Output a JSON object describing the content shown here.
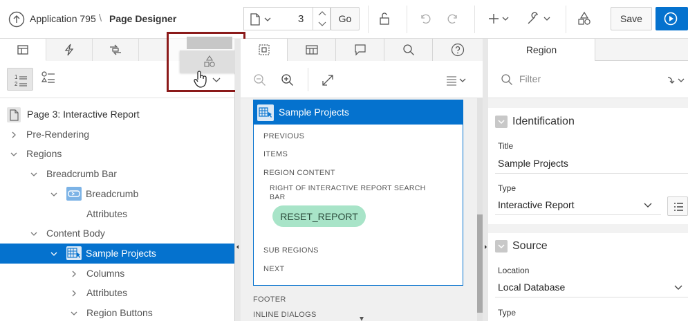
{
  "toolbar": {
    "app_label": "Application 795",
    "separator": "\\",
    "page_designer_label": "Page Designer",
    "page_number": "3",
    "go_label": "Go",
    "save_label": "Save"
  },
  "left_pane": {
    "tabs": [
      "rendering-tab",
      "dynamic-actions-tab",
      "processing-tab",
      "shared-components-tab"
    ],
    "tree": [
      {
        "label": "Page 3: Interactive Report",
        "level": 0,
        "icon": "page-icon"
      },
      {
        "label": "Pre-Rendering",
        "level": 0,
        "chevron": "right"
      },
      {
        "label": "Regions",
        "level": 0,
        "chevron": "down"
      },
      {
        "label": "Breadcrumb Bar",
        "level": 1,
        "chevron": "down"
      },
      {
        "label": "Breadcrumb",
        "level": 2,
        "chevron": "down",
        "icon": "breadcrumb-icon"
      },
      {
        "label": "Attributes",
        "level": 3
      },
      {
        "label": "Content Body",
        "level": 1,
        "chevron": "down"
      },
      {
        "label": "Sample Projects",
        "level": 2,
        "chevron": "down",
        "icon": "report-icon",
        "selected": true
      },
      {
        "label": "Columns",
        "level": 3,
        "chevron": "right"
      },
      {
        "label": "Attributes",
        "level": 3,
        "chevron": "right"
      },
      {
        "label": "Region Buttons",
        "level": 3,
        "chevron": "down"
      }
    ]
  },
  "middle_pane": {
    "region_title": "Sample Projects",
    "slots": {
      "previous": "PREVIOUS",
      "items": "ITEMS",
      "region_content": "REGION CONTENT",
      "right_of_search_line1": "RIGHT OF INTERACTIVE REPORT SEARCH",
      "right_of_search_line2": "BAR",
      "sub_regions": "SUB REGIONS",
      "next": "NEXT"
    },
    "reset_button": "RESET_REPORT",
    "footer": "FOOTER",
    "inline_dialogs": "INLINE DIALOGS"
  },
  "right_pane": {
    "tab_label": "Region",
    "filter_placeholder": "Filter",
    "identification": {
      "heading": "Identification",
      "title_label": "Title",
      "title_value": "Sample Projects",
      "type_label": "Type",
      "type_value": "Interactive Report"
    },
    "source": {
      "heading": "Source",
      "location_label": "Location",
      "location_value": "Local Database",
      "type_label": "Type"
    }
  },
  "colors": {
    "accent": "#0572ce",
    "highlight_border": "#8b1a1a",
    "reset_button_bg": "#a8e4c8"
  }
}
